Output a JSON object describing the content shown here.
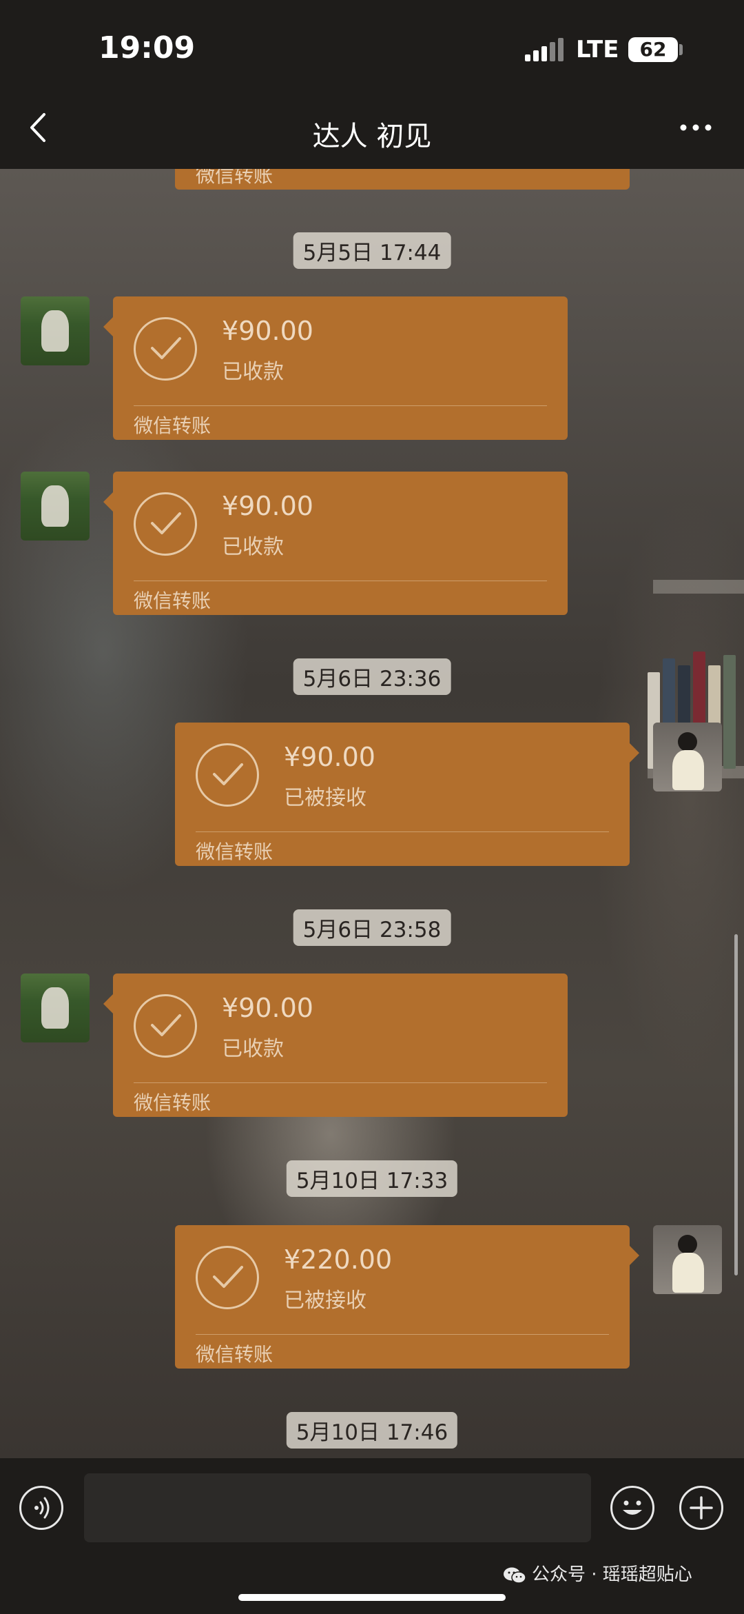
{
  "status_bar": {
    "time": "19:09",
    "network": "LTE",
    "battery": "62"
  },
  "header": {
    "title": "达人 初见"
  },
  "partial_footer": "微信转账",
  "messages": [
    {
      "type": "timestamp",
      "text": "5月5日 17:44"
    },
    {
      "type": "transfer",
      "side": "left",
      "amount": "¥90.00",
      "status": "已收款",
      "footer": "微信转账"
    },
    {
      "type": "transfer",
      "side": "left",
      "amount": "¥90.00",
      "status": "已收款",
      "footer": "微信转账"
    },
    {
      "type": "timestamp",
      "text": "5月6日 23:36"
    },
    {
      "type": "transfer",
      "side": "right",
      "amount": "¥90.00",
      "status": "已被接收",
      "footer": "微信转账"
    },
    {
      "type": "timestamp",
      "text": "5月6日 23:58"
    },
    {
      "type": "transfer",
      "side": "left",
      "amount": "¥90.00",
      "status": "已收款",
      "footer": "微信转账"
    },
    {
      "type": "timestamp",
      "text": "5月10日 17:33"
    },
    {
      "type": "transfer",
      "side": "right",
      "amount": "¥220.00",
      "status": "已被接收",
      "footer": "微信转账"
    },
    {
      "type": "timestamp",
      "text": "5月10日 17:46"
    }
  ],
  "input_bar": {
    "voice_icon": "voice-icon",
    "emoji_icon": "emoji-icon",
    "plus_icon": "plus-icon"
  },
  "watermark": {
    "icon": "wechat-icon",
    "text": "公众号 · 瑶瑶超贴心"
  }
}
